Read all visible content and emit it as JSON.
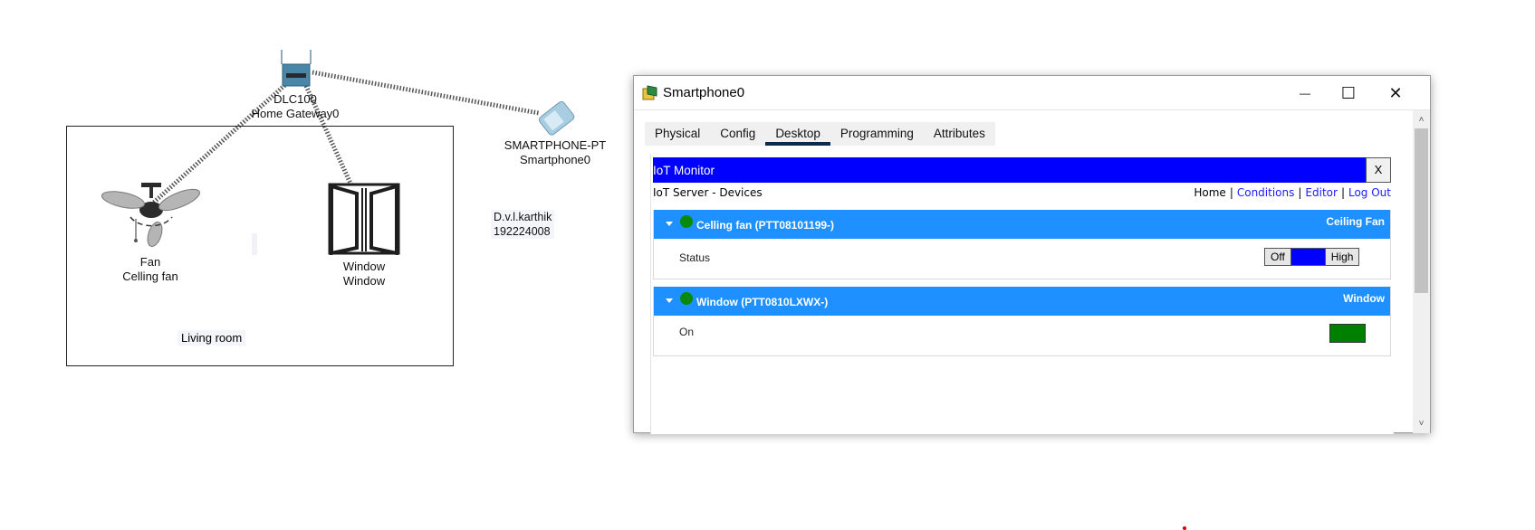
{
  "canvas": {
    "gateway": {
      "model": "DLC100",
      "name": "Home Gateway0"
    },
    "smartphone": {
      "model": "SMARTPHONE-PT",
      "name": "Smartphone0"
    },
    "fan": {
      "model": "Fan",
      "name": "Celling fan"
    },
    "window": {
      "model": "Window",
      "name": "Window"
    },
    "author_note": {
      "line1": "D.v.l.karthik",
      "line2": "192224008"
    },
    "room_label": "Living room"
  },
  "dialog": {
    "title": "Smartphone0",
    "controls": {
      "minimize": "—",
      "maximize": "☐",
      "close": "✕"
    },
    "tabs": [
      "Physical",
      "Config",
      "Desktop",
      "Programming",
      "Attributes"
    ],
    "active_tab": "Desktop",
    "iot": {
      "header_title": "IoT Monitor",
      "close_label": "X",
      "subtitle": "IoT Server - Devices",
      "nav": {
        "home": "Home",
        "conditions": "Conditions",
        "editor": "Editor",
        "logout": "Log Out",
        "separator": "|"
      },
      "devices": [
        {
          "name": "Celling fan (PTT08101199-)",
          "type": "Ceiling Fan",
          "status_color": "#0a8a0a",
          "property": "Status",
          "control": {
            "off_label": "Off",
            "high_label": "High",
            "selected_color": "#0000ff"
          }
        },
        {
          "name": "Window (PTT0810LXWX-)",
          "type": "Window",
          "status_color": "#0a8a0a",
          "property": "On",
          "control": {
            "on_color": "#008000"
          }
        }
      ]
    }
  },
  "colors": {
    "iot_header": "#0000ff",
    "device_header": "#1e90ff",
    "active_tab_underline": "#0b2a4f",
    "link": "#1a1aff"
  }
}
